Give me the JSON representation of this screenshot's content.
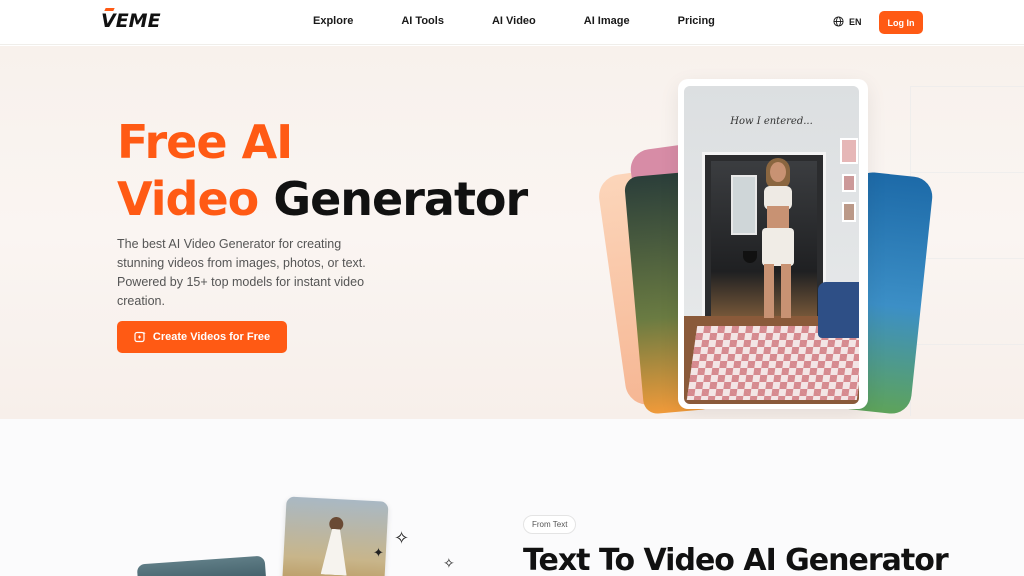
{
  "header": {
    "logo": "VEME",
    "nav": [
      "Explore",
      "AI Tools",
      "AI Video",
      "AI Image",
      "Pricing"
    ],
    "language": "EN",
    "login_label": "Log In"
  },
  "hero": {
    "title_line1": "Free AI",
    "title_line2_accent": "Video",
    "title_line2_rest": "Generator",
    "description": "The best AI Video Generator for creating stunning videos from images, photos, or text. Powered by 15+ top models for instant video creation.",
    "cta_label": "Create Videos for Free",
    "preview_caption": "How I entered..."
  },
  "section2": {
    "badge": "From Text",
    "title": "Text To Video AI Generator"
  },
  "colors": {
    "accent": "#ff5a14",
    "text_dark": "#111111",
    "text_muted": "#555555",
    "hero_bg": "#f8f1ec"
  },
  "icons": [
    "globe-icon",
    "create-video-icon",
    "sparkle-icon"
  ]
}
